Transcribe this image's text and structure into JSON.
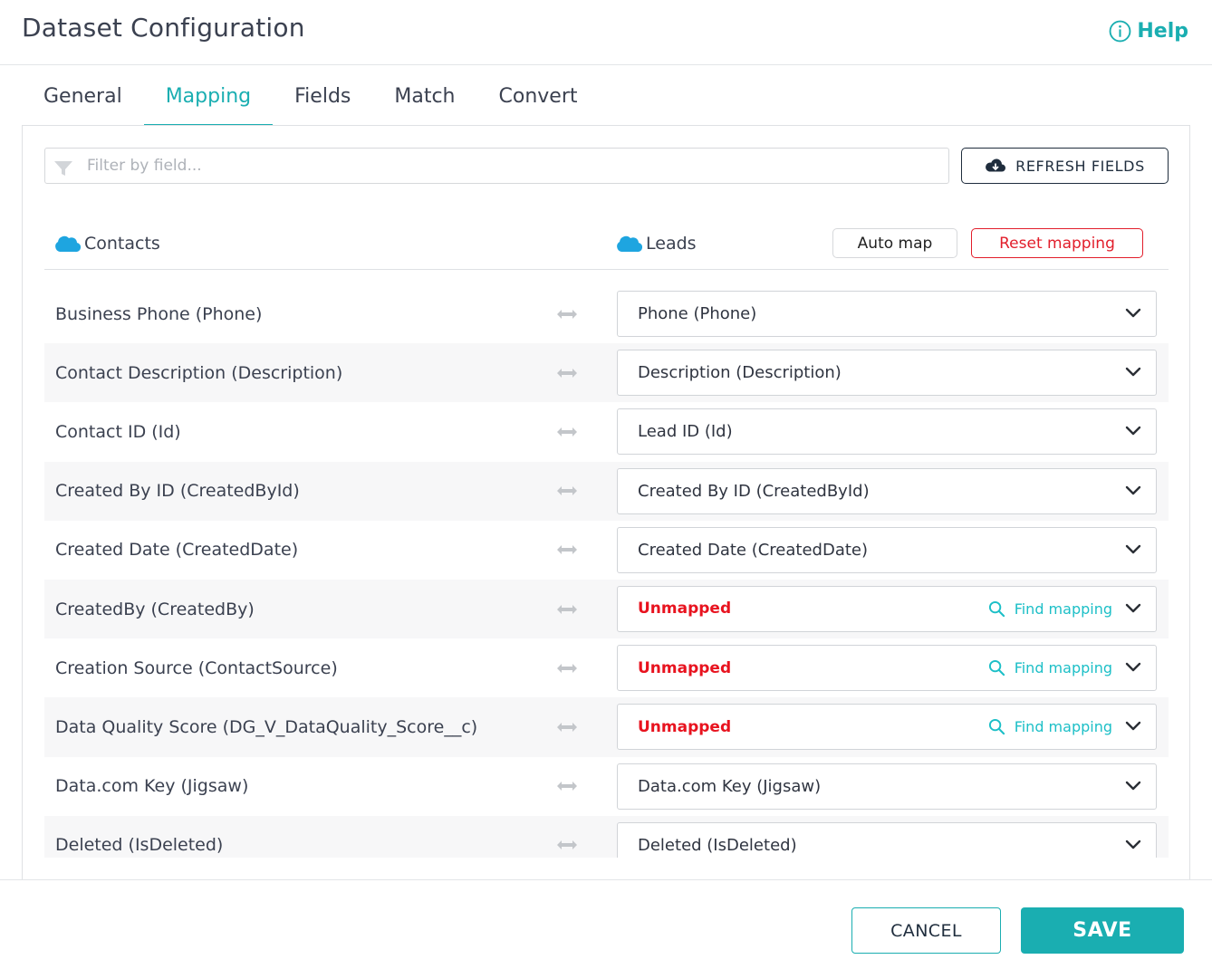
{
  "header": {
    "title": "Dataset Configuration",
    "help_label": "Help"
  },
  "tabs": [
    {
      "label": "General"
    },
    {
      "label": "Mapping"
    },
    {
      "label": "Fields"
    },
    {
      "label": "Match"
    },
    {
      "label": "Convert"
    }
  ],
  "active_tab": "Mapping",
  "filter": {
    "placeholder": "Filter by field...",
    "value": ""
  },
  "refresh_label": "REFRESH FIELDS",
  "source_object": "Contacts",
  "target_object": "Leads",
  "auto_map_label": "Auto map",
  "reset_mapping_label": "Reset mapping",
  "find_mapping_label": "Find mapping",
  "rows": [
    {
      "source": "Business Phone (Phone)",
      "target": "Phone (Phone)",
      "unmapped": false
    },
    {
      "source": "Contact Description (Description)",
      "target": "Description (Description)",
      "unmapped": false
    },
    {
      "source": "Contact ID (Id)",
      "target": "Lead ID (Id)",
      "unmapped": false
    },
    {
      "source": "Created By ID (CreatedById)",
      "target": "Created By ID (CreatedById)",
      "unmapped": false
    },
    {
      "source": "Created Date (CreatedDate)",
      "target": "Created Date (CreatedDate)",
      "unmapped": false
    },
    {
      "source": "CreatedBy (CreatedBy)",
      "target": "Unmapped",
      "unmapped": true
    },
    {
      "source": "Creation Source (ContactSource)",
      "target": "Unmapped",
      "unmapped": true
    },
    {
      "source": "Data Quality Score (DG_V_DataQuality_Score__c)",
      "target": "Unmapped",
      "unmapped": true
    },
    {
      "source": "Data.com Key (Jigsaw)",
      "target": "Data.com Key (Jigsaw)",
      "unmapped": false
    },
    {
      "source": "Deleted (IsDeleted)",
      "target": "Deleted (IsDeleted)",
      "unmapped": false
    }
  ],
  "footer": {
    "cancel_label": "CANCEL",
    "save_label": "SAVE"
  },
  "colors": {
    "accent": "#1aaeb1",
    "danger": "#e21e2b",
    "link": "#1cbfc7",
    "salesforce_blue": "#1ea5e0"
  }
}
